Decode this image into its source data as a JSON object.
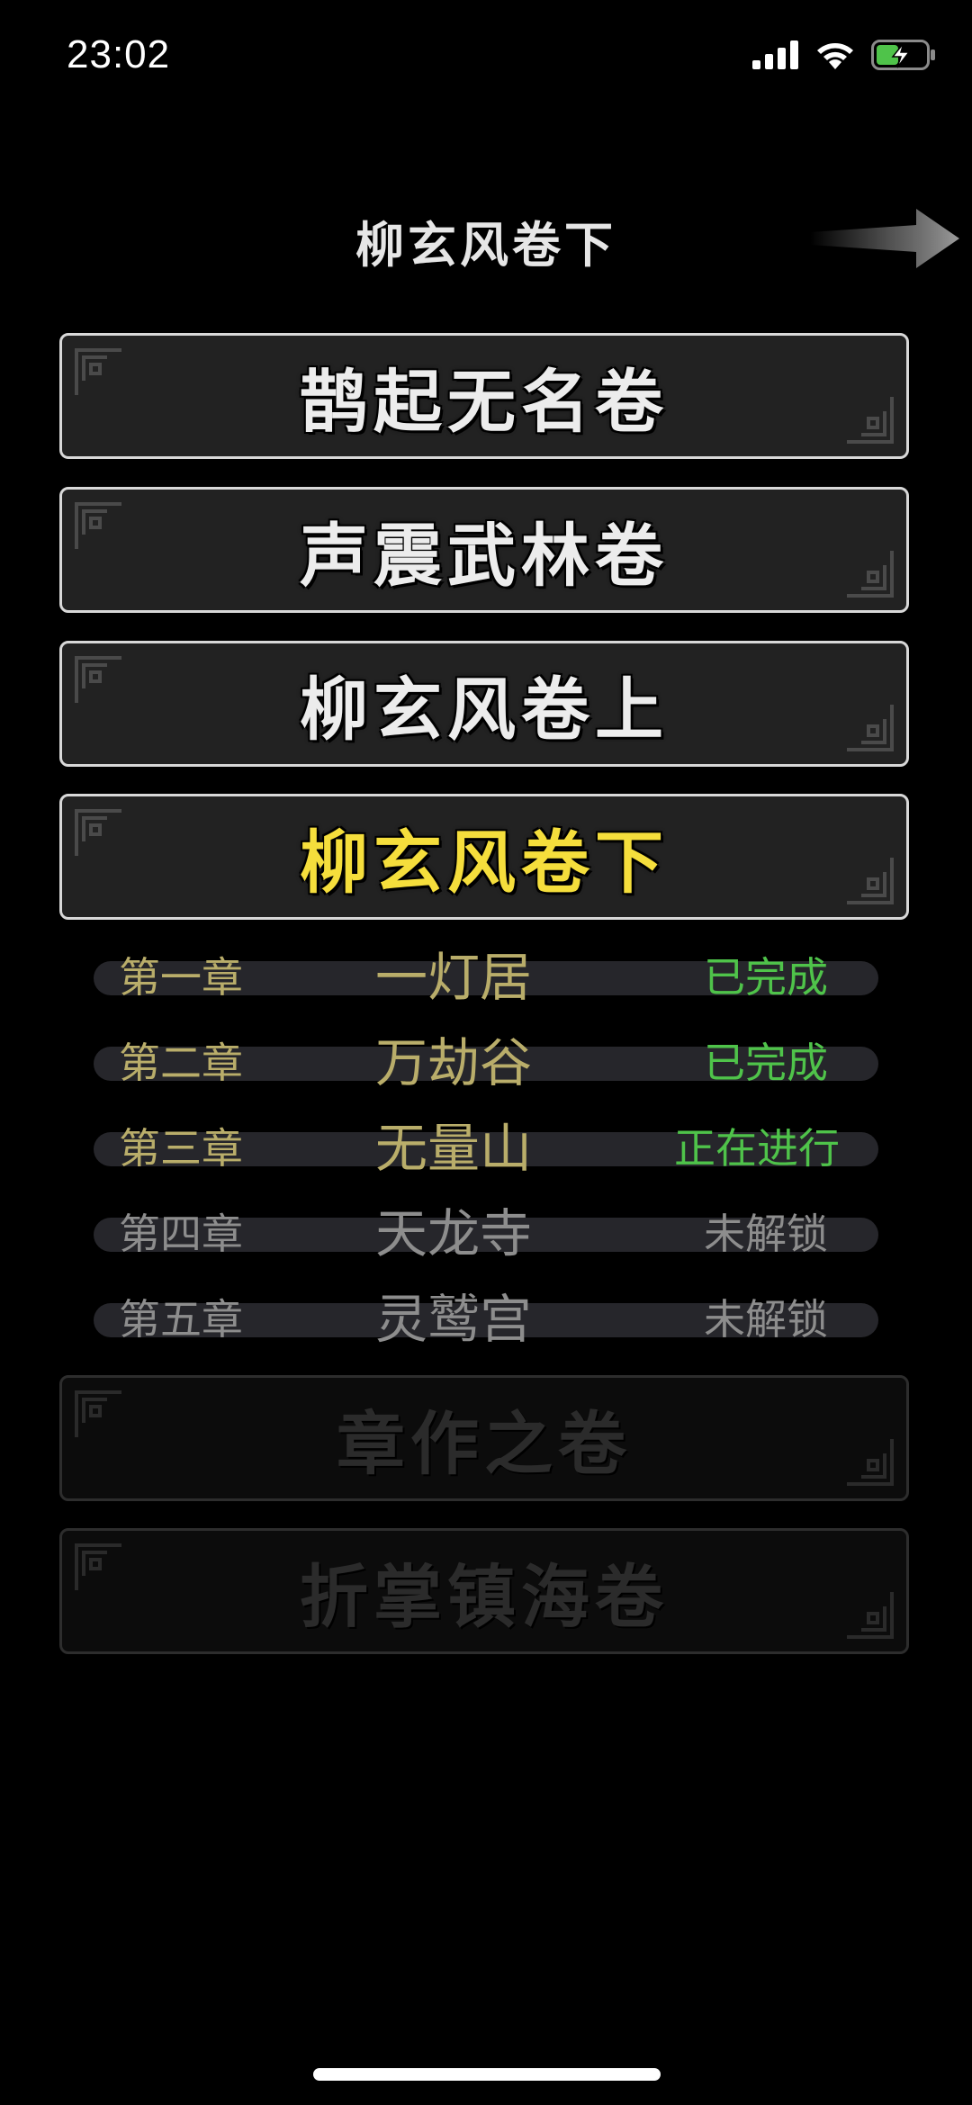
{
  "status_bar": {
    "time": "23:02",
    "icons": [
      "signal-icon",
      "wifi-icon",
      "battery-charging-icon"
    ],
    "battery_color": "#4fc34a"
  },
  "header": {
    "title": "柳玄风卷下",
    "next_icon": "arrow-right-icon"
  },
  "volumes": [
    {
      "label": "鹊起无名卷",
      "state": "normal"
    },
    {
      "label": "声震武林卷",
      "state": "normal"
    },
    {
      "label": "柳玄风卷上",
      "state": "normal"
    },
    {
      "label": "柳玄风卷下",
      "state": "active"
    },
    {
      "label": "章作之卷",
      "state": "locked"
    },
    {
      "label": "折掌镇海卷",
      "state": "locked"
    }
  ],
  "chapters": [
    {
      "num": "第一章",
      "name": "一灯居",
      "status": "已完成"
    },
    {
      "num": "第二章",
      "name": "万劫谷",
      "status": "已完成"
    },
    {
      "num": "第三章",
      "name": "无量山",
      "status": "正在进行"
    },
    {
      "num": "第四章",
      "name": "天龙寺",
      "status": "未解锁"
    },
    {
      "num": "第五章",
      "name": "灵鹫宫",
      "status": "未解锁"
    }
  ],
  "colors": {
    "active_volume": "#f5de3c",
    "chapter_unlocked": "#b9ad6a",
    "status_done": "#4fc34a",
    "locked_text": "#8d8d8d"
  }
}
